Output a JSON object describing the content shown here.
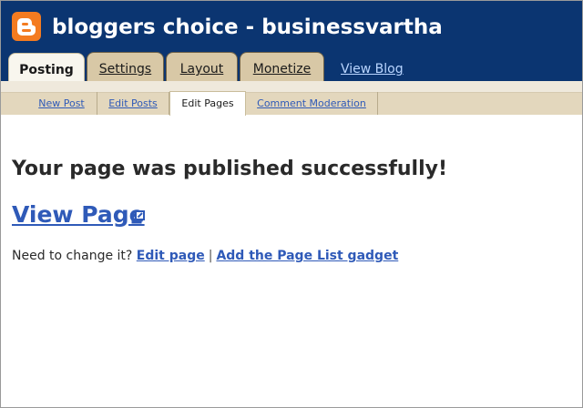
{
  "header": {
    "blog_title": "bloggers choice - businessvartha",
    "logo_icon": "blogger-logo-icon",
    "background_color": "#0b3571"
  },
  "tabs": [
    {
      "label": "Posting",
      "active": true
    },
    {
      "label": "Settings",
      "active": false
    },
    {
      "label": "Layout",
      "active": false
    },
    {
      "label": "Monetize",
      "active": false
    }
  ],
  "view_blog_link": "View Blog",
  "subnav": [
    {
      "label": "New Post",
      "active": false
    },
    {
      "label": "Edit Posts",
      "active": false
    },
    {
      "label": "Edit Pages",
      "active": true
    },
    {
      "label": "Comment Moderation",
      "active": false
    }
  ],
  "main": {
    "success_message": "Your page was published successfully!",
    "view_page_link": "View Page",
    "external_icon": "external-link-icon",
    "change_prompt": "Need to change it?",
    "edit_page_link": "Edit page",
    "separator": "|",
    "add_gadget_link": "Add the Page List gadget"
  },
  "colors": {
    "link": "#2f5ab8",
    "tab_background": "#d8c8a6",
    "logo": "#f47b20"
  }
}
